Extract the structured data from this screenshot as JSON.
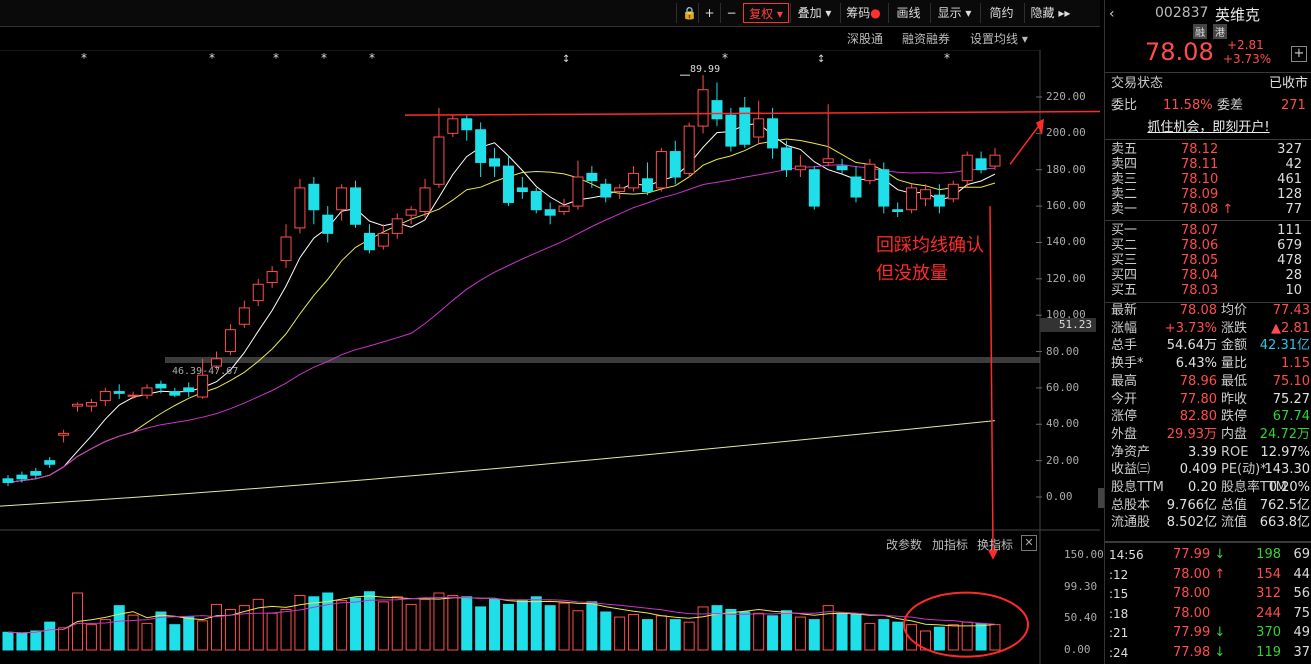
{
  "toolbar": {
    "buttons": [
      "复权",
      "叠加",
      "筹码",
      "画线",
      "显示",
      "简约",
      "隐藏"
    ],
    "sub_links": [
      "深股通",
      "融资融券",
      "设置均线"
    ]
  },
  "chart_data": [
    {
      "type": "candlestick",
      "title": "",
      "ylim": [
        0,
        220
      ],
      "yticks": [
        "220.00",
        "200.00",
        "180.00",
        "160.00",
        "140.00",
        "120.00",
        "100.00",
        "80.00",
        "60.00",
        "40.00",
        "20.00",
        "0.00"
      ],
      "current_label": "51.23",
      "annotations": [
        "89.99",
        "46.39-47.67"
      ],
      "note": "回踩均线确认\n但没放量"
    },
    {
      "type": "bar",
      "title": "",
      "ylim": [
        0,
        150
      ],
      "yticks": [
        "150.00",
        "99.30",
        "50.40",
        "0.00"
      ],
      "header_links": [
        "改参数",
        "加指标",
        "换指标"
      ]
    }
  ],
  "quote": {
    "code": "002837",
    "name": "英维克",
    "tags": [
      "融",
      "港"
    ],
    "price": "78.08",
    "change": "+2.81",
    "change_pct": "+3.73%",
    "status_label": "交易状态",
    "status_value": "已收市",
    "weibi_label": "委比",
    "weibi_value": "11.58%",
    "weicha_label": "委差",
    "weicha_value": "271",
    "promo": "抓住机会，即刻开户!"
  },
  "order_book": {
    "sell": [
      {
        "label": "卖五",
        "price": "78.12",
        "vol": "327"
      },
      {
        "label": "卖四",
        "price": "78.11",
        "vol": "42"
      },
      {
        "label": "卖三",
        "price": "78.10",
        "vol": "461"
      },
      {
        "label": "卖二",
        "price": "78.09",
        "vol": "128"
      },
      {
        "label": "卖一",
        "price": "78.08",
        "vol": "77"
      }
    ],
    "buy": [
      {
        "label": "买一",
        "price": "78.07",
        "vol": "111"
      },
      {
        "label": "买二",
        "price": "78.06",
        "vol": "679"
      },
      {
        "label": "买三",
        "price": "78.05",
        "vol": "478"
      },
      {
        "label": "买四",
        "price": "78.04",
        "vol": "28"
      },
      {
        "label": "买五",
        "price": "78.03",
        "vol": "10"
      }
    ]
  },
  "stats": [
    [
      "最新",
      "78.08",
      "均价",
      "77.43"
    ],
    [
      "涨幅",
      "+3.73%",
      "涨跌",
      "▲2.81"
    ],
    [
      "总手",
      "54.64万",
      "金额",
      "42.31亿"
    ],
    [
      "换手*",
      "6.43%",
      "量比",
      "1.15"
    ],
    [
      "最高",
      "78.96",
      "最低",
      "75.10"
    ],
    [
      "今开",
      "77.80",
      "昨收",
      "75.27"
    ],
    [
      "涨停",
      "82.80",
      "跌停",
      "67.74"
    ],
    [
      "外盘",
      "29.93万",
      "内盘",
      "24.72万"
    ],
    [
      "净资产",
      "3.39",
      "ROE",
      "12.97%"
    ],
    [
      "收益㈢",
      "0.409",
      "PE(动)*",
      "143.30"
    ],
    [
      "股息TTM",
      "0.20",
      "股息率TTM",
      "0.20%"
    ],
    [
      "总股本",
      "9.766亿",
      "总值",
      "762.5亿"
    ],
    [
      "流通股",
      "8.502亿",
      "流值",
      "663.8亿"
    ]
  ],
  "ticks": [
    {
      "time": "14:56",
      "price": "77.99",
      "dir": "down",
      "vol": "198",
      "n": "69"
    },
    {
      "time": ":12",
      "price": "78.00",
      "dir": "up",
      "vol": "154",
      "n": "44"
    },
    {
      "time": ":15",
      "price": "78.00",
      "dir": "",
      "vol": "312",
      "n": "56"
    },
    {
      "time": ":18",
      "price": "78.00",
      "dir": "",
      "vol": "244",
      "n": "75"
    },
    {
      "time": ":21",
      "price": "77.99",
      "dir": "down",
      "vol": "370",
      "n": "49"
    },
    {
      "time": ":24",
      "price": "77.98",
      "dir": "down",
      "vol": "119",
      "n": "37"
    }
  ],
  "colors": {
    "up": "#ff4d4d",
    "down": "#1fe0e8",
    "ma5": "#ffffff",
    "ma10": "#e8e84a",
    "ma20": "#cc33cc",
    "annot": "#ff2a2a"
  }
}
